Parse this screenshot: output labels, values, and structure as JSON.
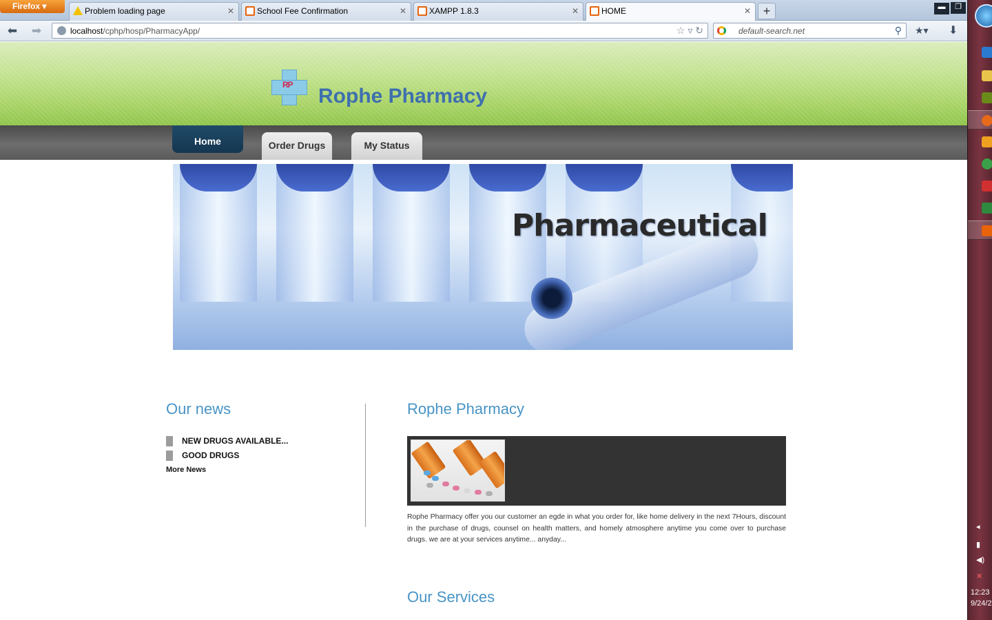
{
  "browser": {
    "menu_button": "Firefox",
    "tabs": [
      {
        "label": "Problem loading page",
        "icon": "warning-icon"
      },
      {
        "label": "School Fee Confirmation",
        "icon": "xampp-icon"
      },
      {
        "label": "XAMPP 1.8.3",
        "icon": "xampp-icon"
      },
      {
        "label": "HOME",
        "icon": "xampp-icon",
        "active": true
      }
    ],
    "url_host": "localhost",
    "url_path": "/cphp/hosp/PharmacyApp/",
    "search_placeholder": "default-search.net"
  },
  "site": {
    "logo_letters": "RP",
    "title": "Rophe Pharmacy",
    "menu": [
      "Home",
      "Order Drugs",
      "My Status"
    ],
    "banner_word": "Pharmaceutical",
    "news": {
      "title": "Our news",
      "items": [
        "NEW DRUGS AVAILABLE...",
        "GOOD DRUGS"
      ],
      "more": "More News"
    },
    "about": {
      "title": "Rophe Pharmacy",
      "text": "Rophe Pharmacy offer you our customer an egde in what you order for, like home delivery in the next 7Hours, discount in the purchase of drugs, counsel on health matters, and homely atmosphere anytime you come over to purchase drugs. we are at your services anytime... anyday..."
    },
    "services_title": "Our Services"
  },
  "taskbar": {
    "time": "12:23",
    "date": "9/24/2"
  },
  "colors": {
    "header_green": "#a8d365",
    "menu_active": "#1f4a68",
    "heading_blue": "#4894c6",
    "title_blue": "#3e6fae"
  }
}
